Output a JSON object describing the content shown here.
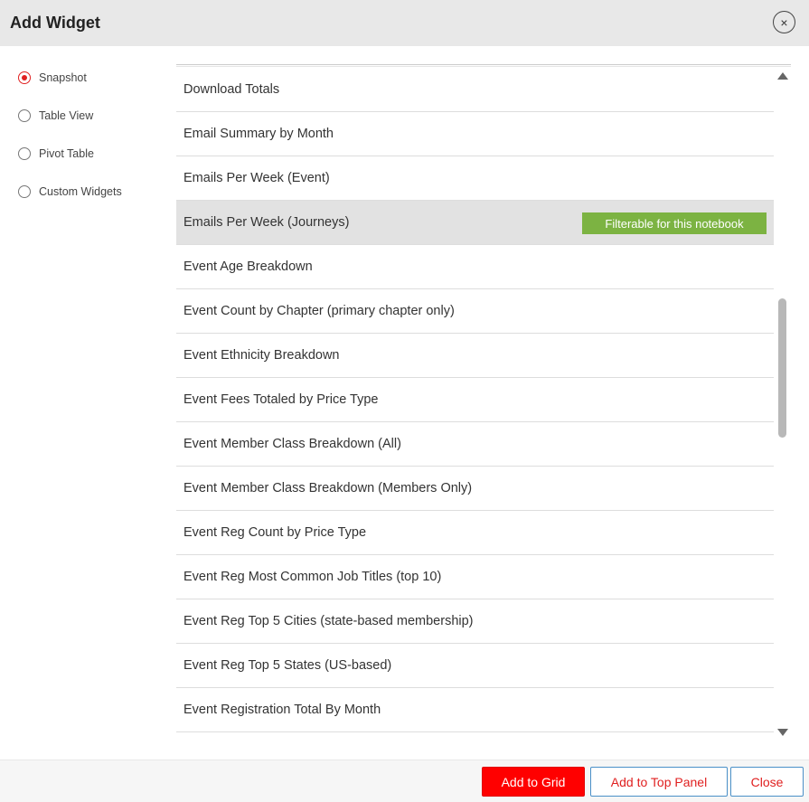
{
  "dialog": {
    "title": "Add Widget",
    "close_icon": "×"
  },
  "sidebar": {
    "options": [
      {
        "label": "Snapshot",
        "checked": true
      },
      {
        "label": "Table View",
        "checked": false
      },
      {
        "label": "Pivot Table",
        "checked": false
      },
      {
        "label": "Custom Widgets",
        "checked": false
      }
    ]
  },
  "list": {
    "items": [
      {
        "label": "Download Totals"
      },
      {
        "label": "Email Summary by Month"
      },
      {
        "label": "Emails Per Week (Event)"
      },
      {
        "label": "Emails Per Week (Journeys)",
        "selected": true,
        "badge": "Filterable for this notebook"
      },
      {
        "label": "Event Age Breakdown"
      },
      {
        "label": "Event Count by Chapter (primary chapter only)"
      },
      {
        "label": "Event Ethnicity Breakdown"
      },
      {
        "label": "Event Fees Totaled by Price Type"
      },
      {
        "label": "Event Member Class Breakdown (All)"
      },
      {
        "label": "Event Member Class Breakdown (Members Only)"
      },
      {
        "label": "Event Reg Count by Price Type"
      },
      {
        "label": "Event Reg Most Common Job Titles (top 10)"
      },
      {
        "label": "Event Reg Top 5 Cities (state-based membership)"
      },
      {
        "label": "Event Reg Top 5 States (US-based)"
      },
      {
        "label": "Event Registration Total By Month"
      }
    ]
  },
  "footer": {
    "add_to_grid": "Add to Grid",
    "add_to_top_panel": "Add to Top Panel",
    "close": "Close"
  },
  "colors": {
    "accent_red": "#ff0000",
    "badge_green": "#7cb342",
    "selected_row": "#e2e2e2",
    "header_bg": "#e8e8e8"
  }
}
